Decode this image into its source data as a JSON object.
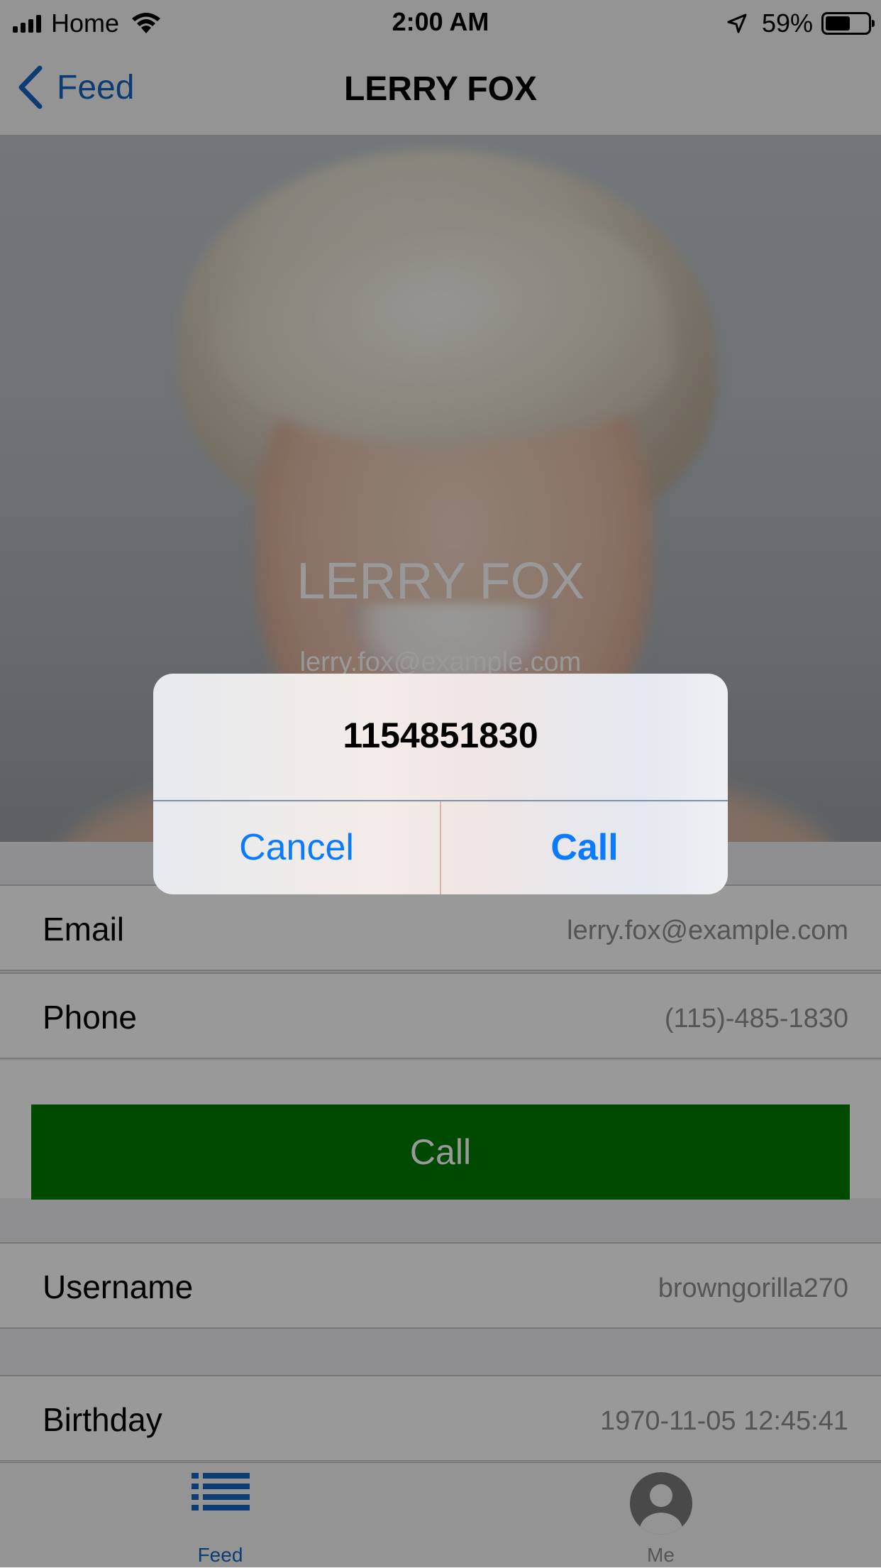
{
  "status_bar": {
    "carrier": "Home",
    "time": "2:00 AM",
    "battery_percent": "59%",
    "battery_level": 0.59,
    "icons": [
      "signal-icon",
      "wifi-icon",
      "location-arrow-icon",
      "battery-icon"
    ]
  },
  "nav": {
    "back_label": "Feed",
    "title": "LERRY FOX"
  },
  "profile": {
    "name": "LERRY FOX",
    "email": "lerry.fox@example.com"
  },
  "rows": {
    "email_label": "Email",
    "email_value": "lerry.fox@example.com",
    "phone_label": "Phone",
    "phone_value": "(115)-485-1830",
    "call_button_label": "Call",
    "username_label": "Username",
    "username_value": "browngorilla270",
    "birthday_label": "Birthday",
    "birthday_value": "1970-11-05 12:45:41"
  },
  "tabs": [
    {
      "label": "Feed",
      "icon": "list-icon",
      "selected": true
    },
    {
      "label": "Me",
      "icon": "person-icon",
      "selected": false
    }
  ],
  "alert": {
    "title": "1154851830",
    "cancel_label": "Cancel",
    "call_label": "Call"
  },
  "colors": {
    "accent": "#1565c0",
    "call_button": "#007a00",
    "alert_button": "#0a7aff"
  }
}
